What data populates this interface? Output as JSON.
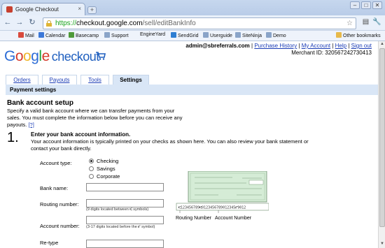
{
  "browser": {
    "tab_title": "Google Checkout",
    "tab_close": "×",
    "new_tab": "+",
    "win_minimize": "–",
    "win_maximize": "□",
    "win_close": "✕",
    "back": "←",
    "forward": "→",
    "reload": "↻",
    "url_scheme": "https://",
    "url_host": "checkout.google.com",
    "url_path": "/sell/editBankInfo",
    "star": "☆",
    "page_menu": "▤",
    "tools_menu": "🔧",
    "bookmarks": [
      {
        "label": "Mail",
        "color": "#d94a3c"
      },
      {
        "label": "Calendar",
        "color": "#3c78d8"
      },
      {
        "label": "Basecamp",
        "color": "#4f9a39"
      },
      {
        "label": "Support",
        "color": "#8aa4c8"
      },
      {
        "label": "EngineYard",
        "color": "#ffffff"
      },
      {
        "label": "SendGrid",
        "color": "#2d7dd2"
      },
      {
        "label": "Userguide",
        "color": "#8aa4c8"
      },
      {
        "label": "SiteNinja",
        "color": "#8aa4c8"
      },
      {
        "label": "Demo",
        "color": "#8aa4c8"
      }
    ],
    "other_bookmarks": "Other bookmarks"
  },
  "header": {
    "logo_g1": "G",
    "logo_g2": "o",
    "logo_g3": "o",
    "logo_g4": "g",
    "logo_g5": "l",
    "logo_g6": "e",
    "logo_checkout": "checkout",
    "email": "admin@sbreferrals.com",
    "sep": " | ",
    "links": [
      "Purchase History",
      "My Account",
      "Help",
      "Sign out"
    ],
    "merchant_id": "Merchant ID: 320567242730413"
  },
  "tabs": {
    "orders": "Orders",
    "payouts": "Payouts",
    "tools": "Tools",
    "settings": "Settings"
  },
  "subheader": "Payment settings",
  "bank": {
    "title": "Bank account setup",
    "intro": "Specify a valid bank account where we can transfer payments from your sales. You must complete the information below before you can receive any payouts.",
    "intro_link": "[?]",
    "step_number": "1.",
    "step_title": "Enter your bank account information.",
    "step_desc": "Your account information is typically printed on your checks as shown here. You can also review your bank statement or contact your bank directly.",
    "account_type_label": "Account type:",
    "account_types": [
      "Checking",
      "Savings",
      "Corporate"
    ],
    "selected_type": "Checking",
    "bank_name_label": "Bank name:",
    "routing_label": "Routing number:",
    "routing_hint": "(9 digits located between ⑆ symbols)",
    "account_label": "Account number:",
    "account_hint": "(3-17 digits located before the ⑈ symbol)",
    "retype_label": "Re-type",
    "routing_caption": "Routing Number",
    "account_caption": "Account Number",
    "micr_line": "⑆123456789⑆0123456789012345⑈9012"
  }
}
